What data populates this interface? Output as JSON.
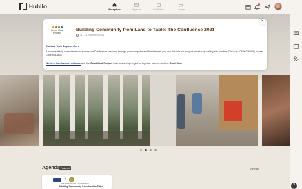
{
  "app": {
    "brand": "Hubilo"
  },
  "nav": {
    "items": [
      {
        "label": "Reception",
        "icon": "home-icon",
        "active": true
      },
      {
        "label": "Agenda",
        "icon": "calendar-icon",
        "active": false
      },
      {
        "label": "Exhibitors",
        "icon": "store-icon",
        "active": false
      },
      {
        "label": "Lounge",
        "icon": "lounge-icon",
        "active": false
      }
    ]
  },
  "announcement": {
    "logo_text": "Good Meat Project",
    "title": "Building Community from Land to Table: The Confluence 2021",
    "date": "11 - 13 November 2021",
    "support_link": "Contact Tech Support Here",
    "body": "If you absolutely cannot seem to access our Confluence sessions through your computer and the internet, you can dial into our support session by calling this number: Dial In # 408-962-6400 | Access Code 5318834",
    "foot_link1": "Western Landowners Alliance",
    "foot_and": " and the ",
    "foot_link2": "Good Meat Project",
    "foot_rest": " have teamed up to gather together women workin...",
    "read_more": "Read More",
    "close": "×"
  },
  "carousel": {
    "count": 4,
    "active_index": 1
  },
  "agenda": {
    "title": "Agenda",
    "badge": "Featured",
    "view_all": "View all",
    "card": {
      "subtitle": "WE ARE GOING TO CONNECT",
      "title": "Building Community from Land to Table"
    }
  },
  "help": "?",
  "colors": {
    "accent": "#c0632e",
    "link": "#1f3a8a",
    "title": "#5a3a22",
    "background": "#ece7df"
  }
}
